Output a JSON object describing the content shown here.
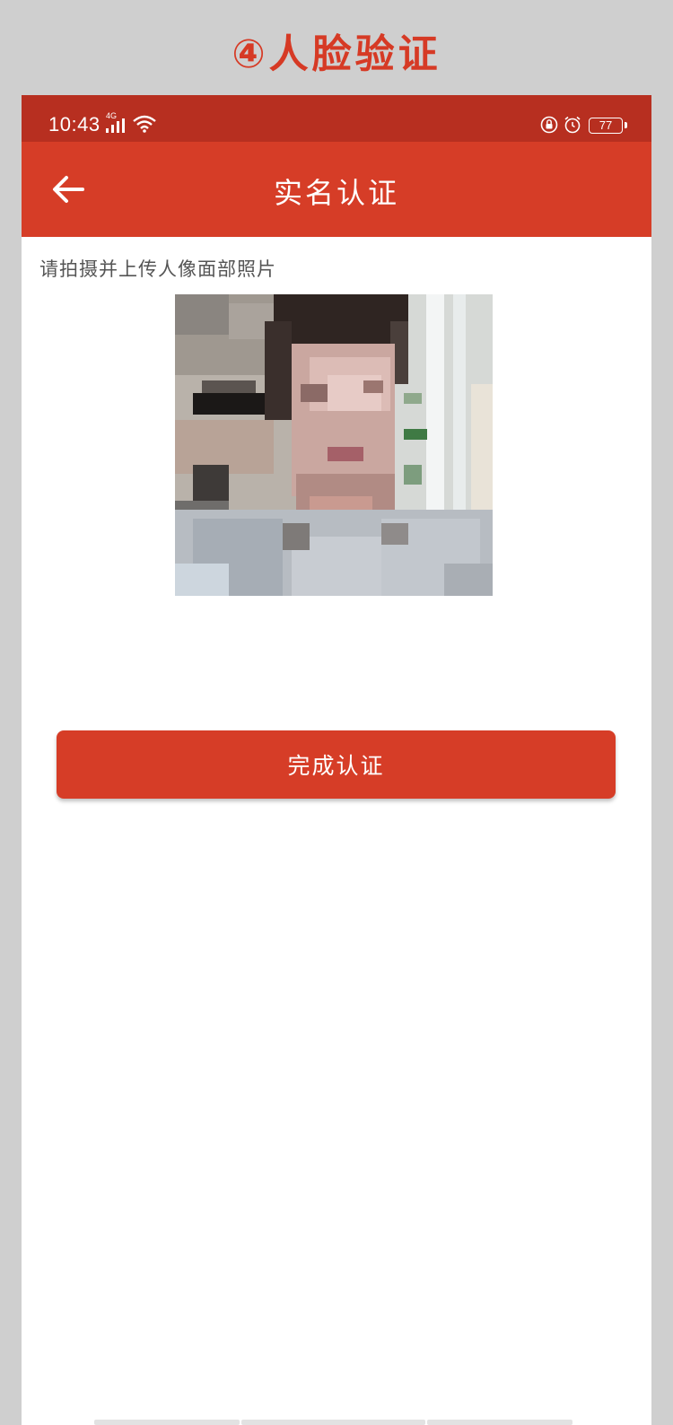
{
  "caption": {
    "text": "④人脸验证",
    "color": "#d63a25"
  },
  "status_bar": {
    "time": "10:43",
    "network": "4G",
    "battery": "77",
    "icons": [
      "signal-icon",
      "wifi-icon",
      "lock-icon",
      "alarm-icon",
      "battery-icon"
    ],
    "background": "#b72f20"
  },
  "app_bar": {
    "title": "实名认证",
    "back_icon": "arrow-left-icon",
    "background": "#d63d27"
  },
  "content": {
    "instruction": "请拍摄并上传人像面部照片",
    "photo": "pixelated-face-photo"
  },
  "actions": {
    "complete_label": "完成认证",
    "button_color": "#d63d27"
  }
}
